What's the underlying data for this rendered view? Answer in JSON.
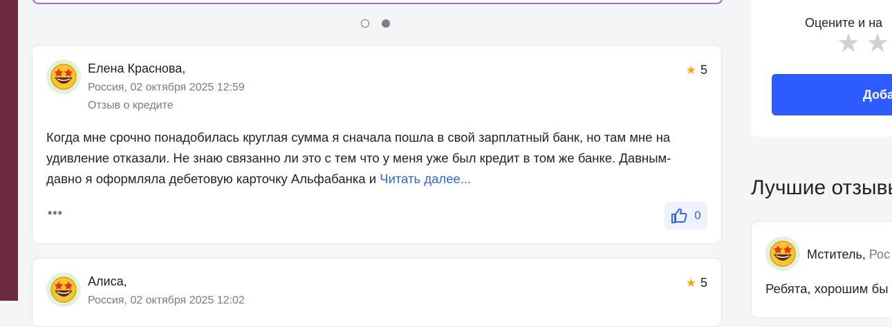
{
  "carousel": {
    "active_index": 1,
    "count": 2
  },
  "reviews": [
    {
      "author": "Елена Краснова,",
      "location_date": "Россия, 02 октября 2025 12:59",
      "kind": "Отзыв о кредите",
      "rating": "5",
      "text": "Когда мне срочно понадобилась круглая сумма я сначала пошла в свой зарплатный банк, но там мне на удивление отказали. Не знаю связанно ли это с тем что у меня уже был кредит в том же банке. Давным-давно я оформляла дебетовую карточку Альфабанка и ",
      "read_more": "Читать далее...",
      "more_menu": "•••",
      "likes": "0"
    },
    {
      "author": "Алиса,",
      "location_date": "Россия, 02 октября 2025 12:02",
      "rating": "5"
    }
  ],
  "sidebar": {
    "rate_label": "Оцените и на",
    "add_button": "Доба"
  },
  "best_reviews": {
    "title": "Лучшие отзывы",
    "item": {
      "author": "Мститель, ",
      "location": "Рос",
      "text": "Ребята, хорошим бы"
    }
  },
  "colors": {
    "accent": "#2d63f0",
    "star": "#f5a800",
    "left_strip": "#6b2b3f",
    "carousel_border": "#9d6ae3"
  },
  "icons": {
    "avatar": "star-struck-emoji-icon",
    "rating": "star-icon",
    "like": "thumbs-up-icon"
  }
}
